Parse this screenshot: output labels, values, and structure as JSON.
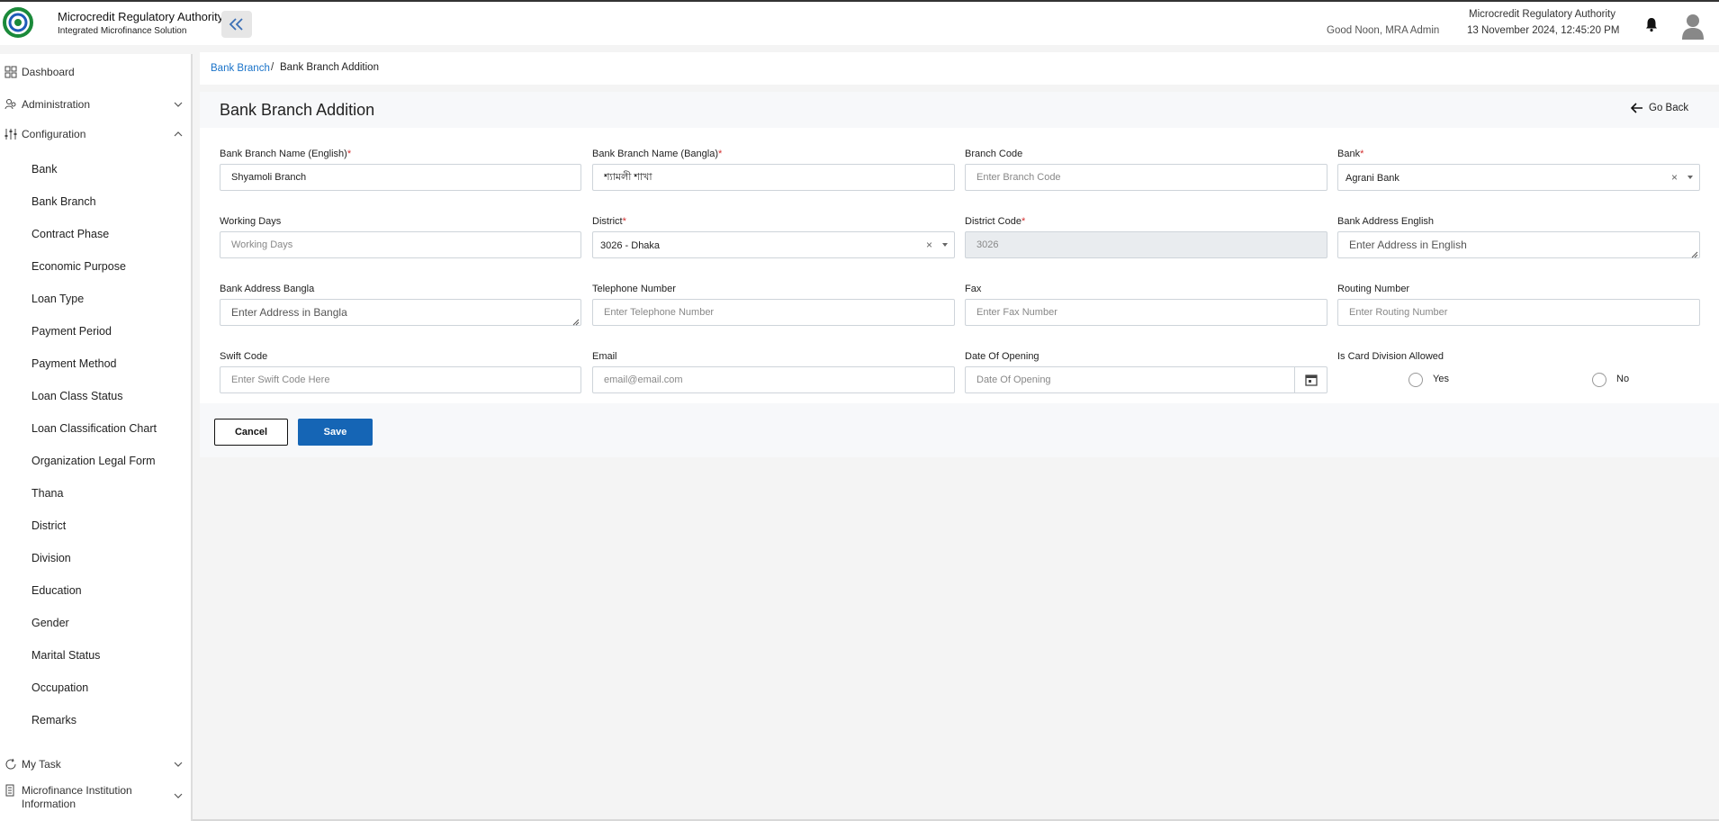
{
  "header": {
    "logo_text": "Microcredit Regulatory Authority",
    "app_name": "Microcredit Regulatory Authority",
    "app_subtitle": "Integrated Microfinance Solution",
    "greeting": "Good Noon, MRA Admin",
    "org_name": "Microcredit Regulatory Authority",
    "datetime": "13 November 2024, 12:45:20 PM"
  },
  "sidebar": {
    "dashboard": "Dashboard",
    "administration": "Administration",
    "configuration": "Configuration",
    "config_items": [
      "Bank",
      "Bank Branch",
      "Contract Phase",
      "Economic Purpose",
      "Loan Type",
      "Payment Period",
      "Payment Method",
      "Loan Class Status",
      "Loan Classification Chart",
      "Organization Legal Form",
      "Thana",
      "District",
      "Division",
      "Education",
      "Gender",
      "Marital Status",
      "Occupation",
      "Remarks"
    ],
    "my_task": "My Task",
    "mfi_info": "Microfinance Institution Information"
  },
  "breadcrumb": {
    "parent": "Bank Branch",
    "separator": "/",
    "current": "Bank Branch Addition"
  },
  "form": {
    "title": "Bank Branch Addition",
    "go_back": "Go Back",
    "name_en": {
      "label": "Bank Branch Name (English)",
      "value": "Shyamoli Branch"
    },
    "name_bn": {
      "label": "Bank Branch Name (Bangla)",
      "value": "শ্যামলী শাখা"
    },
    "branch_code": {
      "label": "Branch Code",
      "placeholder": "Enter Branch Code"
    },
    "bank": {
      "label": "Bank",
      "value": "Agrani Bank"
    },
    "working_days": {
      "label": "Working Days",
      "placeholder": "Working Days"
    },
    "district": {
      "label": "District",
      "value": "3026 - Dhaka"
    },
    "district_code": {
      "label": "District Code",
      "value": "3026"
    },
    "address_en": {
      "label": "Bank Address English",
      "placeholder": "Enter Address in English"
    },
    "address_bn": {
      "label": "Bank Address Bangla",
      "placeholder": "Enter Address in Bangla"
    },
    "telephone": {
      "label": "Telephone Number",
      "placeholder": "Enter Telephone Number"
    },
    "fax": {
      "label": "Fax",
      "placeholder": "Enter Fax Number"
    },
    "routing": {
      "label": "Routing Number",
      "placeholder": "Enter Routing Number"
    },
    "swift": {
      "label": "Swift Code",
      "placeholder": "Enter Swift Code Here"
    },
    "email": {
      "label": "Email",
      "placeholder": "email@email.com"
    },
    "date_opening": {
      "label": "Date Of Opening",
      "placeholder": "Date Of Opening"
    },
    "card_division": {
      "label": "Is Card Division Allowed",
      "yes": "Yes",
      "no": "No"
    },
    "required_mark": "*",
    "cancel": "Cancel",
    "save": "Save"
  },
  "colors": {
    "primary": "#1565b5",
    "link": "#1a73c9",
    "required": "#d32f2f"
  }
}
